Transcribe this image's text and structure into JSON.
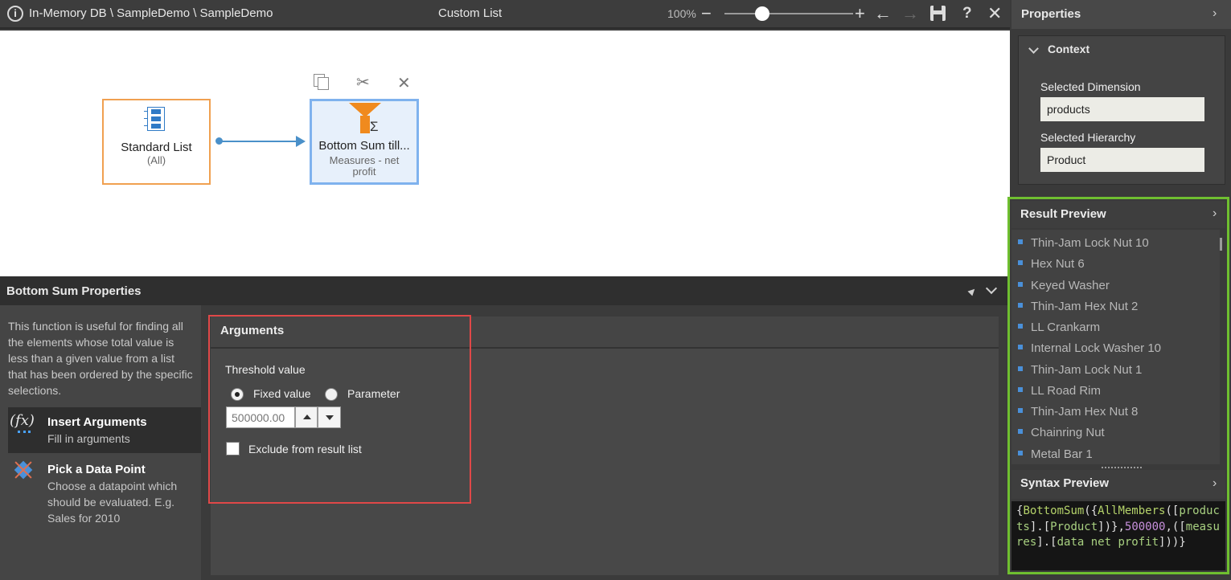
{
  "topbar": {
    "info_icon": "i",
    "path": "In-Memory DB \\ SampleDemo \\ SampleDemo",
    "title": "Custom List",
    "zoom": "100%",
    "help": "?"
  },
  "canvas": {
    "nodes": [
      {
        "label": "Standard List",
        "sub": "(All)"
      },
      {
        "label": "Bottom Sum till...",
        "sub": "Measures - net profit"
      }
    ],
    "sigma": "Σ"
  },
  "properties_panel": {
    "title": "Bottom Sum Properties",
    "description": "This function is useful for finding all the elements whose total value is less than a given value from a list that has been ordered by the specific selections.",
    "steps": [
      {
        "title": "Insert Arguments",
        "desc": "Fill in arguments",
        "icon_text": "fx"
      },
      {
        "title": "Pick a Data Point",
        "desc": "Choose a datapoint which should be evaluated. E.g. Sales for 2010"
      }
    ]
  },
  "arguments": {
    "title": "Arguments",
    "threshold_label": "Threshold value",
    "fixed_label": "Fixed value",
    "parameter_label": "Parameter",
    "threshold_value": "500000.00",
    "exclude_label": "Exclude from result list"
  },
  "right": {
    "properties_title": "Properties",
    "context_title": "Context",
    "selected_dimension_label": "Selected Dimension",
    "selected_dimension_value": "products",
    "selected_hierarchy_label": "Selected Hierarchy",
    "selected_hierarchy_value": "Product",
    "result_preview_title": "Result Preview",
    "result_items": [
      "Thin-Jam Lock Nut 10",
      "Hex Nut 6",
      "Keyed Washer",
      "Thin-Jam Hex Nut 2",
      "LL Crankarm",
      "Internal Lock Washer 10",
      "Thin-Jam Lock Nut 1",
      "LL Road Rim",
      "Thin-Jam Hex Nut 8",
      "Chainring Nut",
      "Metal Bar 1"
    ],
    "syntax_preview_title": "Syntax Preview",
    "syntax": {
      "p1": "{",
      "p2": "BottomSum",
      "p3": "({",
      "p4": "AllMembers",
      "p5": "([",
      "p6": "products",
      "p7": "].[",
      "p8": "Product",
      "p9": "])},",
      "p10": "500000",
      "p11": ",([",
      "p12": "measures",
      "p13": "].[",
      "p14": "data net profit",
      "p15": "]))}"
    }
  },
  "colors": {
    "accent_blue": "#4a90d9",
    "highlight_red": "#e04848",
    "highlight_green": "#6fbf30",
    "node_orange": "#f0a050",
    "funnel_orange": "#f08a1e"
  }
}
